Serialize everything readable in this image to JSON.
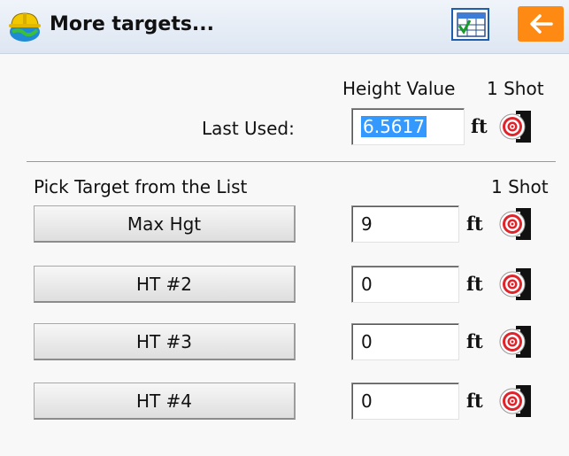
{
  "window": {
    "title": "More targets...",
    "icons": {
      "app": "hardhat-globe-icon",
      "grid": "grid-check-icon",
      "back": "arrow-left-icon"
    }
  },
  "header": {
    "height_value": "Height Value",
    "one_shot": "1 Shot"
  },
  "last_used": {
    "label": "Last Used:",
    "value": "6.5617",
    "unit": "ft"
  },
  "list": {
    "title": "Pick Target from the List",
    "one_shot": "1 Shot",
    "targets": [
      {
        "label": "Max Hgt",
        "value": "9",
        "unit": "ft"
      },
      {
        "label": "HT #2",
        "value": "0",
        "unit": "ft"
      },
      {
        "label": "HT #3",
        "value": "0",
        "unit": "ft"
      },
      {
        "label": "HT #4",
        "value": "0",
        "unit": "ft"
      }
    ]
  },
  "colors": {
    "accent": "#fe8a14",
    "selection": "#3399ff",
    "target_red": "#e0242c"
  }
}
